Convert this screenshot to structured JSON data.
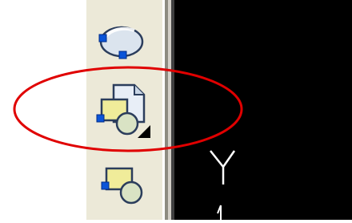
{
  "toolbar": {
    "tools": [
      {
        "name": "ellipse",
        "icon": "ellipse-tool-icon"
      },
      {
        "name": "make-block",
        "icon": "make-block-tool-icon",
        "highlighted": true
      },
      {
        "name": "insert-block",
        "icon": "insert-block-tool-icon"
      }
    ]
  },
  "drawing_area": {
    "ucs_axis_label": "Y"
  },
  "annotation": {
    "shape": "ellipse",
    "color": "#e00000"
  }
}
